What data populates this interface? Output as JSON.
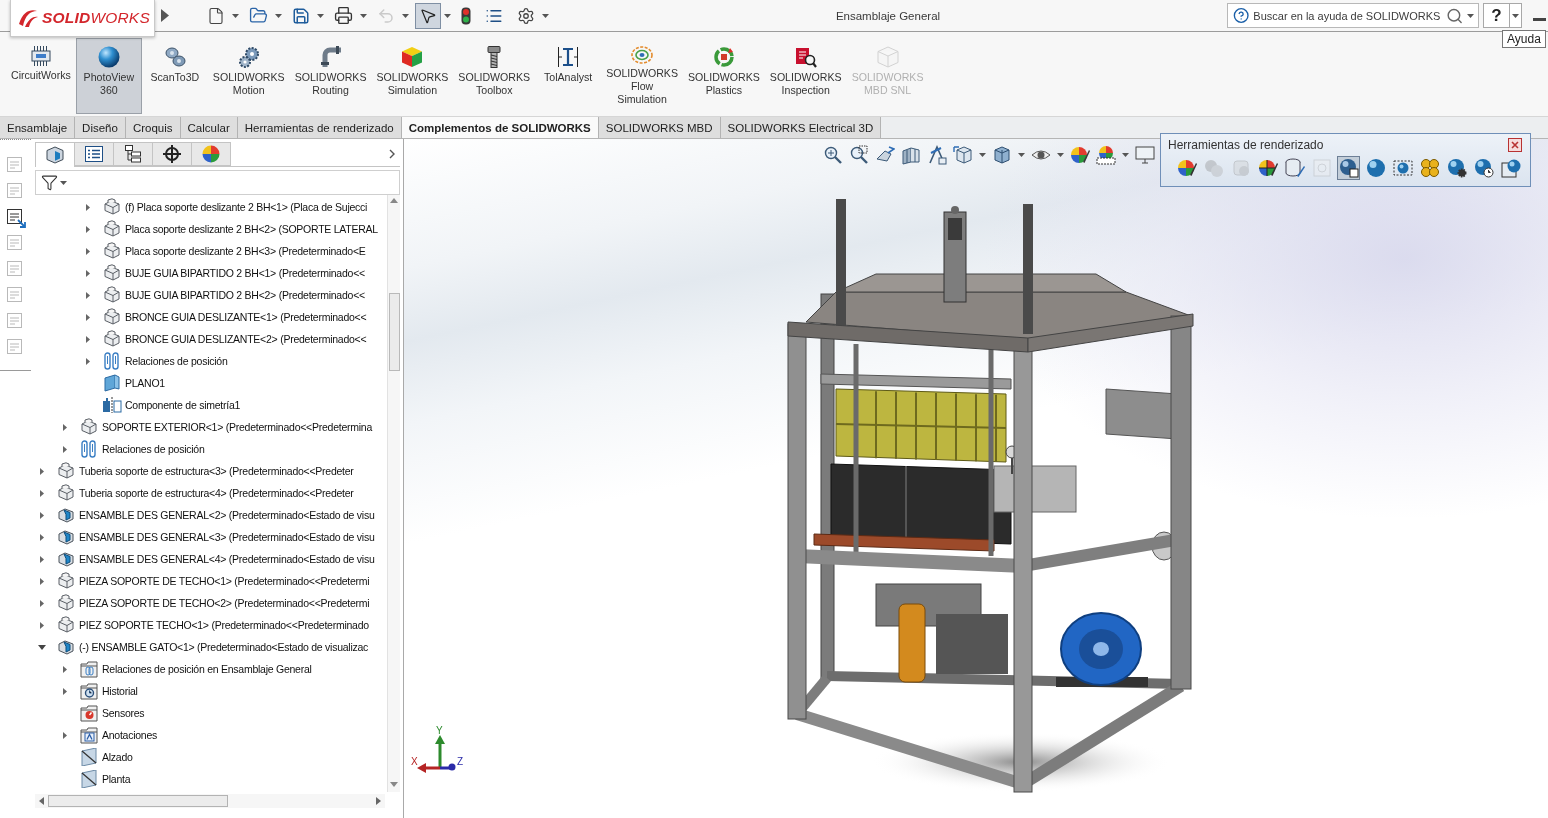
{
  "title_bar": {
    "logo": "**SOLID**WORKS",
    "quick_access": [
      {
        "dropdown": true,
        "disabled": false,
        "pressed": false
      },
      {
        "dropdown": true,
        "disabled": false,
        "pressed": false
      },
      {
        "dropdown": true,
        "disabled": false,
        "pressed": false
      },
      {
        "dropdown": true,
        "disabled": false,
        "pressed": false
      },
      {
        "dropdown": true,
        "disabled": true,
        "pressed": false
      },
      {
        "dropdown": true,
        "disabled": false,
        "pressed": true
      },
      {
        "dropdown": false,
        "disabled": false,
        "pressed": false
      },
      {
        "dropdown": false,
        "disabled": false,
        "pressed": false
      },
      {
        "dropdown": true,
        "disabled": false,
        "pressed": false
      }
    ],
    "title": "Ensamblaje General",
    "search": {
      "placeholder": "Buscar en la ayuda de SOLIDWORKS"
    },
    "help_button": {
      "label": "?"
    },
    "tooltip": "Ayuda"
  },
  "ribbon": {
    "buttons": [
      {
        "label": "CircuitWorks",
        "selected": false,
        "disabled": false
      },
      {
        "label": "PhotoView\n360",
        "selected": true,
        "disabled": false
      },
      {
        "label": "ScanTo3D",
        "selected": false,
        "disabled": false
      },
      {
        "label": "SOLIDWORKS\nMotion",
        "selected": false,
        "disabled": false
      },
      {
        "label": "SOLIDWORKS\nRouting",
        "selected": false,
        "disabled": false
      },
      {
        "label": "SOLIDWORKS\nSimulation",
        "selected": false,
        "disabled": false
      },
      {
        "label": "SOLIDWORKS\nToolbox",
        "selected": false,
        "disabled": false
      },
      {
        "label": "TolAnalyst",
        "selected": false,
        "disabled": false
      },
      {
        "label": "SOLIDWORKS\nFlow\nSimulation",
        "selected": false,
        "disabled": false
      },
      {
        "label": "SOLIDWORKS\nPlastics",
        "selected": false,
        "disabled": false
      },
      {
        "label": "SOLIDWORKS\nInspection",
        "selected": false,
        "disabled": false
      },
      {
        "label": "SOLIDWORKS\nMBD SNL",
        "selected": false,
        "disabled": true
      }
    ]
  },
  "tabs": [
    {
      "label": "Ensamblaje",
      "selected": false
    },
    {
      "label": "Diseño",
      "selected": false
    },
    {
      "label": "Croquis",
      "selected": false
    },
    {
      "label": "Calcular",
      "selected": false
    },
    {
      "label": "Herramientas de renderizado",
      "selected": false
    },
    {
      "label": "Complementos de SOLIDWORKS",
      "selected": true
    },
    {
      "label": "SOLIDWORKS MBD",
      "selected": false
    },
    {
      "label": "SOLIDWORKS Electrical 3D",
      "selected": false
    }
  ],
  "side_tools": [
    {
      "disabled": true
    },
    {
      "disabled": true
    },
    {
      "disabled": false
    },
    {
      "disabled": true
    },
    {
      "disabled": true
    },
    {
      "disabled": true
    },
    {
      "disabled": true
    },
    {
      "disabled": true
    }
  ],
  "panel_tabs": [
    {
      "selected": true
    },
    {
      "selected": false
    },
    {
      "selected": false
    },
    {
      "selected": false
    },
    {
      "selected": false
    }
  ],
  "tree": {
    "items": [
      {
        "children": [
          {
            "children": [
              {
                "label": "(f) Placa soporte deslizante 2 BH<1> (Placa de Sujecci",
                "kind": "part",
                "expanded": false
              },
              {
                "label": "Placa soporte deslizante 2 BH<2> (SOPORTE LATERAL",
                "kind": "part",
                "expanded": false
              },
              {
                "label": "Placa soporte deslizante 2 BH<3> (Predeterminado<E",
                "kind": "part",
                "expanded": false
              },
              {
                "label": "BUJE GUIA BIPARTIDO 2 BH<1> (Predeterminado<<",
                "kind": "part",
                "expanded": false
              },
              {
                "label": "BUJE GUIA BIPARTIDO 2 BH<2> (Predeterminado<<",
                "kind": "part",
                "expanded": false
              },
              {
                "label": "BRONCE GUIA DESLIZANTE<1> (Predeterminado<<",
                "kind": "part",
                "expanded": false
              },
              {
                "label": "BRONCE GUIA DESLIZANTE<2> (Predeterminado<<",
                "kind": "part",
                "expanded": false
              },
              {
                "label": "Relaciones de posición",
                "kind": "mates",
                "expanded": false
              },
              {
                "label": "PLANO1",
                "kind": "plane"
              },
              {
                "label": "Componente de simetría1",
                "kind": "mirror"
              }
            ]
          },
          {
            "label": "SOPORTE EXTERIOR<1> (Predeterminado<<Predetermina",
            "kind": "part",
            "expanded": false
          },
          {
            "label": "Relaciones de posición",
            "kind": "mates",
            "expanded": false
          }
        ]
      },
      {
        "label": "Tuberia soporte de estructura<3> (Predeterminado<<Predeter",
        "kind": "part",
        "expanded": false
      },
      {
        "label": "Tuberia soporte de estructura<4> (Predeterminado<<Predeter",
        "kind": "part",
        "expanded": false
      },
      {
        "label": "ENSAMBLE DES GENERAL<2> (Predeterminado<Estado de visu",
        "kind": "assembly",
        "expanded": false
      },
      {
        "label": "ENSAMBLE DES GENERAL<3> (Predeterminado<Estado de visu",
        "kind": "assembly",
        "expanded": false
      },
      {
        "label": "ENSAMBLE DES GENERAL<4> (Predeterminado<Estado de visu",
        "kind": "assembly",
        "expanded": false
      },
      {
        "label": "PIEZA SOPORTE DE TECHO<1> (Predeterminado<<Predetermi",
        "kind": "part",
        "expanded": false
      },
      {
        "label": "PIEZA SOPORTE DE TECHO<2> (Predeterminado<<Predetermi",
        "kind": "part",
        "expanded": false
      },
      {
        "label": "PIEZ SOPORTE TECHO<1> (Predeterminado<<Predeterminado",
        "kind": "part",
        "expanded": false
      },
      {
        "label": "(-) ENSAMBLE GATO<1> (Predeterminado<Estado de visualizac",
        "kind": "assembly",
        "expanded": true,
        "children": [
          {
            "label": "Relaciones de posición en Ensamblaje General",
            "kind": "matesfolder",
            "expanded": false
          },
          {
            "label": "Historial",
            "kind": "history",
            "expanded": false
          },
          {
            "label": "Sensores",
            "kind": "sensors"
          },
          {
            "label": "Anotaciones",
            "kind": "annotations",
            "expanded": false
          },
          {
            "label": "Alzado",
            "kind": "refplane"
          },
          {
            "label": "Planta",
            "kind": "refplane"
          }
        ]
      }
    ]
  },
  "render_tools": {
    "title": "Herramientas de renderizado",
    "tools": [
      {
        "disabled": false,
        "selected": false
      },
      {
        "disabled": true,
        "selected": false
      },
      {
        "disabled": true,
        "selected": false
      },
      {
        "disabled": false,
        "selected": false
      },
      {
        "disabled": false,
        "selected": false
      },
      {
        "disabled": true,
        "selected": false
      },
      {
        "disabled": false,
        "selected": true
      },
      {
        "disabled": false,
        "selected": false
      },
      {
        "disabled": false,
        "selected": false
      },
      {
        "disabled": false,
        "selected": false
      },
      {
        "disabled": false,
        "selected": false
      },
      {
        "disabled": false,
        "selected": false
      },
      {
        "disabled": false,
        "selected": false
      }
    ]
  },
  "triad": {
    "labels": [
      "X",
      "Y",
      "Z"
    ]
  }
}
